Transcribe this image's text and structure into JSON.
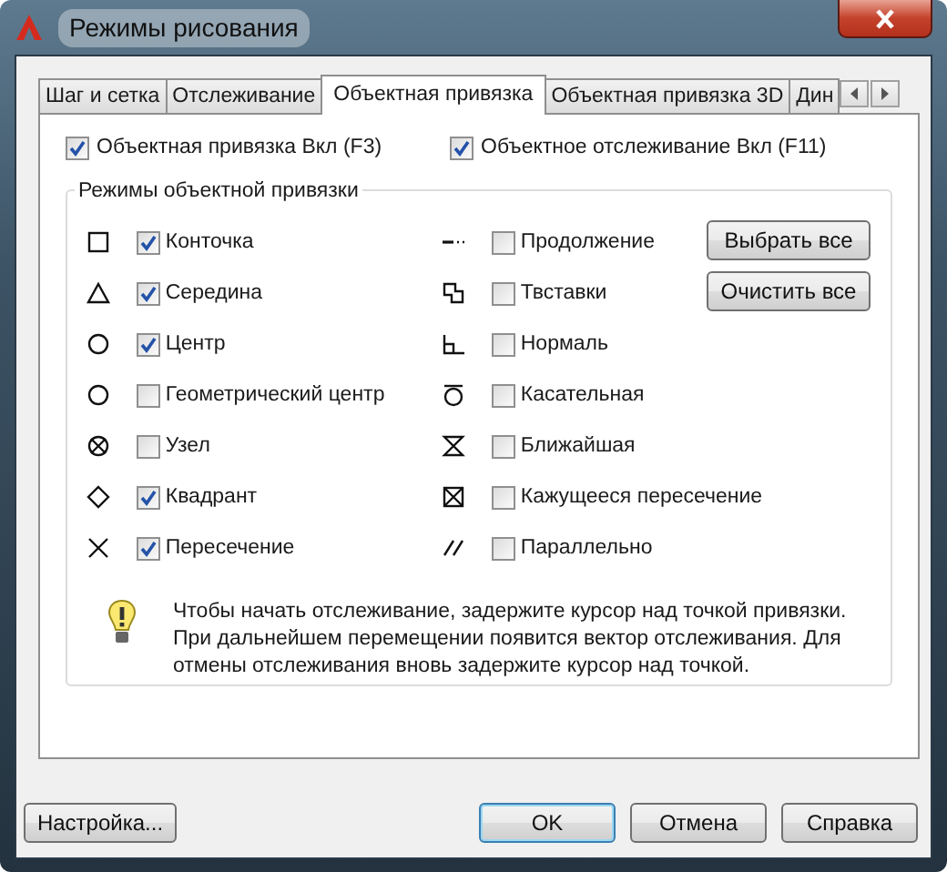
{
  "window": {
    "title": "Режимы рисования"
  },
  "tabs": [
    {
      "label": "Шаг и сетка",
      "selected": false
    },
    {
      "label": "Отслеживание",
      "selected": false
    },
    {
      "label": "Объектная привязка",
      "selected": true
    },
    {
      "label": "Объектная привязка 3D",
      "selected": false
    },
    {
      "label": "Дин",
      "selected": false
    }
  ],
  "top_options": [
    {
      "label": "Объектная привязка Вкл (F3)",
      "checked": true
    },
    {
      "label": "Объектное отслеживание Вкл (F11)",
      "checked": true
    }
  ],
  "group": {
    "title": "Режимы объектной привязки",
    "modes": [
      {
        "kind": "square",
        "label": "Конточка",
        "checked": true
      },
      {
        "kind": "triangle",
        "label": "Середина",
        "checked": true
      },
      {
        "kind": "circle",
        "label": "Центр",
        "checked": true
      },
      {
        "kind": "circle",
        "label": "Геометрический центр",
        "checked": false
      },
      {
        "kind": "node",
        "label": "Узел",
        "checked": false
      },
      {
        "kind": "diamond",
        "label": "Квадрант",
        "checked": true
      },
      {
        "kind": "cross",
        "label": "Пересечение",
        "checked": true
      },
      {
        "kind": "extension",
        "label": "Продолжение",
        "checked": false
      },
      {
        "kind": "insertion",
        "label": "Твставки",
        "checked": false
      },
      {
        "kind": "perpendicular",
        "label": "Нормаль",
        "checked": false
      },
      {
        "kind": "tangent",
        "label": "Касательная",
        "checked": false
      },
      {
        "kind": "nearest",
        "label": "Ближайшая",
        "checked": false
      },
      {
        "kind": "apparent",
        "label": "Кажущееся пересечение",
        "checked": false
      },
      {
        "kind": "parallel",
        "label": "Параллельно",
        "checked": false
      }
    ],
    "buttons": [
      "Выбрать все",
      "Очистить все"
    ],
    "hint": "Чтобы начать отслеживание, задержите курсор над точкой привязки. При дальнейшем перемещении появится вектор отслеживания. Для отмены отслеживания вновь задержите курсор над точкой."
  },
  "footer": {
    "options_button": "Настройка...",
    "buttons": [
      "OK",
      "Отмена",
      "Справка"
    ]
  }
}
